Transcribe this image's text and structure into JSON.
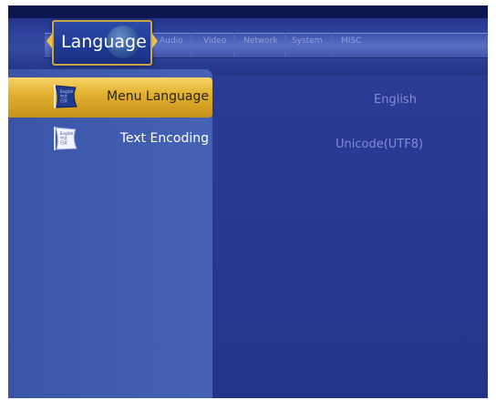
{
  "menu": {
    "active_tab": "Language",
    "tabs": [
      "Audio",
      "Video",
      "Network",
      "System",
      "MISC"
    ]
  },
  "settings": [
    {
      "label": "Menu Language",
      "value": "English",
      "selected": true,
      "icon": "language-flag-icon",
      "icon_text": "English\n中文\n日文"
    },
    {
      "label": "Text Encoding",
      "value": "Unicode(UTF8)",
      "selected": false,
      "icon": "language-flag-icon",
      "icon_text": "English\n中文\n日文"
    }
  ],
  "colors": {
    "background": "#2a3a94",
    "highlight": "#e3b231",
    "value_text": "#7f8ed0"
  }
}
